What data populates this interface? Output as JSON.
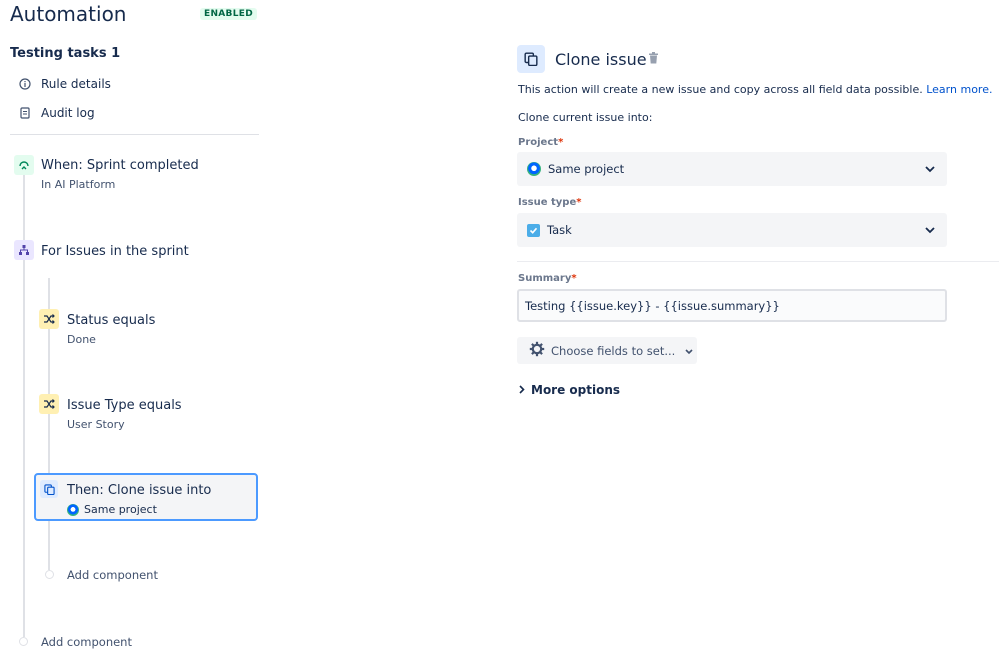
{
  "header": {
    "title": "Automation",
    "status_badge": "ENABLED"
  },
  "rule": {
    "name": "Testing tasks 1",
    "nav": [
      {
        "label": "Rule details",
        "icon": "info-icon"
      },
      {
        "label": "Audit log",
        "icon": "document-icon"
      }
    ]
  },
  "flow": {
    "trigger": {
      "title": "When: Sprint completed",
      "subtitle": "In AI Platform",
      "icon": "sprint-icon"
    },
    "branch": {
      "title": "For Issues in the sprint",
      "icon": "branch-icon"
    },
    "conditions": [
      {
        "title": "Status equals",
        "subtitle": "Done",
        "icon": "shuffle-icon"
      },
      {
        "title": "Issue Type equals",
        "subtitle": "User Story",
        "icon": "shuffle-icon"
      }
    ],
    "action": {
      "title": "Then: Clone issue into",
      "subtitle": "Same project",
      "icon": "clone-icon"
    },
    "add_component_inner": "Add component",
    "add_component_outer": "Add component"
  },
  "panel": {
    "title": "Clone issue",
    "description": "This action will create a new issue and copy across all field data possible.",
    "learn_more": "Learn more.",
    "clone_into_label": "Clone current issue into:",
    "project": {
      "label": "Project",
      "value": "Same project"
    },
    "issue_type": {
      "label": "Issue type",
      "value": "Task"
    },
    "summary": {
      "label": "Summary",
      "value": "Testing {{issue.key}} - {{issue.summary}}"
    },
    "required_mark": "*",
    "choose_fields_button": "Choose fields to set...",
    "more_options": "More options"
  },
  "colors": {
    "accent": "#0052cc",
    "selected_border": "#4c9aff",
    "enabled_badge": "#006644",
    "required": "#de350b"
  }
}
